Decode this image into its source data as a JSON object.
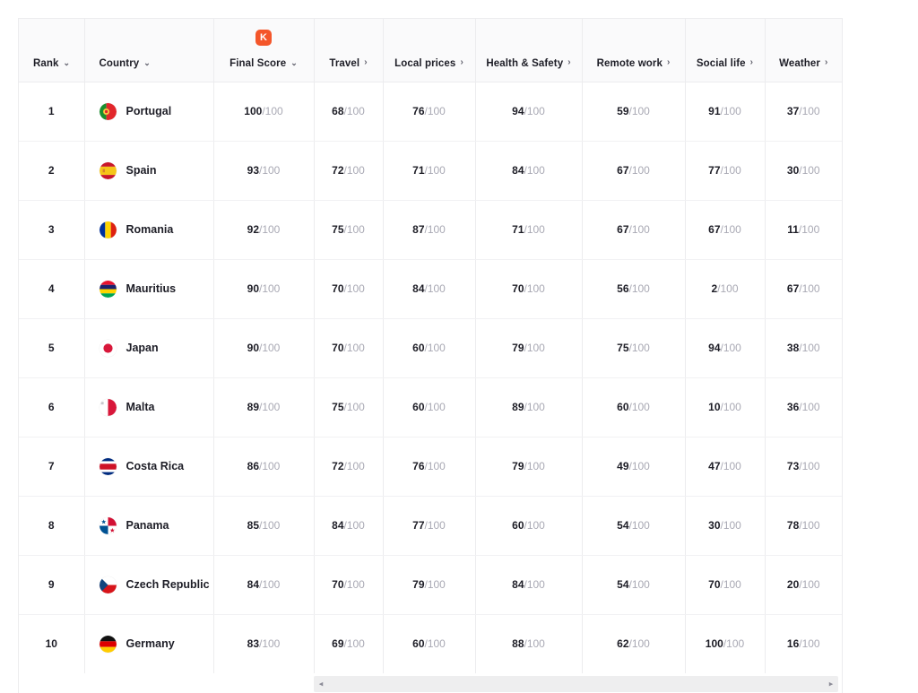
{
  "table": {
    "badge_icon": "k-logo-icon",
    "badge_label": "K",
    "columns": [
      {
        "label": "Rank",
        "sort_icon": "chevron-down-icon",
        "sort_glyph": "⌄"
      },
      {
        "label": "Country",
        "sort_icon": "chevron-down-icon",
        "sort_glyph": "⌄"
      },
      {
        "label": "Final Score",
        "sort_icon": "chevron-down-icon",
        "sort_glyph": "⌄"
      },
      {
        "label": "Travel",
        "sort_icon": "chevron-right-icon",
        "sort_glyph": "›"
      },
      {
        "label": "Local prices",
        "sort_icon": "chevron-right-icon",
        "sort_glyph": "›"
      },
      {
        "label": "Health & Safety",
        "sort_icon": "chevron-right-icon",
        "sort_glyph": "›"
      },
      {
        "label": "Remote work",
        "sort_icon": "chevron-right-icon",
        "sort_glyph": "›"
      },
      {
        "label": "Social life",
        "sort_icon": "chevron-right-icon",
        "sort_glyph": "›"
      },
      {
        "label": "Weather",
        "sort_icon": "chevron-right-icon",
        "sort_glyph": "›"
      }
    ],
    "denominator": "/100",
    "rows": [
      {
        "rank": "1",
        "country": "Portugal",
        "flag": "flag-portugal",
        "final_score": "100",
        "travel": "68",
        "local_prices": "76",
        "health_safety": "94",
        "remote_work": "59",
        "social_life": "91",
        "weather": "37"
      },
      {
        "rank": "2",
        "country": "Spain",
        "flag": "flag-spain",
        "final_score": "93",
        "travel": "72",
        "local_prices": "71",
        "health_safety": "84",
        "remote_work": "67",
        "social_life": "77",
        "weather": "30"
      },
      {
        "rank": "3",
        "country": "Romania",
        "flag": "flag-romania",
        "final_score": "92",
        "travel": "75",
        "local_prices": "87",
        "health_safety": "71",
        "remote_work": "67",
        "social_life": "67",
        "weather": "11"
      },
      {
        "rank": "4",
        "country": "Mauritius",
        "flag": "flag-mauritius",
        "final_score": "90",
        "travel": "70",
        "local_prices": "84",
        "health_safety": "70",
        "remote_work": "56",
        "social_life": "2",
        "weather": "67"
      },
      {
        "rank": "5",
        "country": "Japan",
        "flag": "flag-japan",
        "final_score": "90",
        "travel": "70",
        "local_prices": "60",
        "health_safety": "79",
        "remote_work": "75",
        "social_life": "94",
        "weather": "38"
      },
      {
        "rank": "6",
        "country": "Malta",
        "flag": "flag-malta",
        "final_score": "89",
        "travel": "75",
        "local_prices": "60",
        "health_safety": "89",
        "remote_work": "60",
        "social_life": "10",
        "weather": "36"
      },
      {
        "rank": "7",
        "country": "Costa Rica",
        "flag": "flag-costa-rica",
        "final_score": "86",
        "travel": "72",
        "local_prices": "76",
        "health_safety": "79",
        "remote_work": "49",
        "social_life": "47",
        "weather": "73"
      },
      {
        "rank": "8",
        "country": "Panama",
        "flag": "flag-panama",
        "final_score": "85",
        "travel": "84",
        "local_prices": "77",
        "health_safety": "60",
        "remote_work": "54",
        "social_life": "30",
        "weather": "78"
      },
      {
        "rank": "9",
        "country": "Czech Republic",
        "flag": "flag-czech-republic",
        "final_score": "84",
        "travel": "70",
        "local_prices": "79",
        "health_safety": "84",
        "remote_work": "54",
        "social_life": "70",
        "weather": "20"
      },
      {
        "rank": "10",
        "country": "Germany",
        "flag": "flag-germany",
        "final_score": "83",
        "travel": "69",
        "local_prices": "60",
        "health_safety": "88",
        "remote_work": "62",
        "social_life": "100",
        "weather": "16"
      }
    ]
  },
  "scrollbar": {
    "left_arrow_glyph": "◂",
    "right_arrow_glyph": "▸"
  },
  "colors": {
    "accent": "#f4562a",
    "text": "#1d1d26",
    "muted": "#a9a9b4",
    "border": "#ececee",
    "header_bg": "#fafafb"
  }
}
